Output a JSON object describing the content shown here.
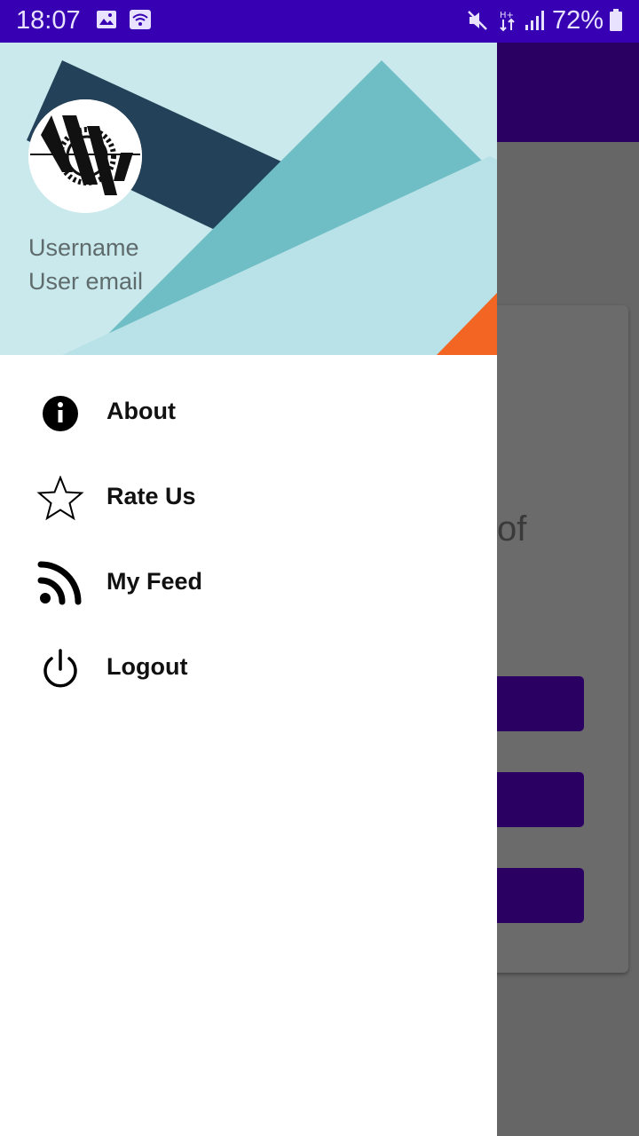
{
  "status_bar": {
    "time": "18:07",
    "battery": "72%",
    "icons": [
      "image-icon",
      "wifi-icon",
      "mute-icon",
      "data-arrows-icon",
      "signal-icon",
      "battery-icon"
    ]
  },
  "drawer": {
    "header": {
      "username": "Username",
      "email": "User email"
    },
    "items": [
      {
        "label": "About",
        "icon": "info-icon"
      },
      {
        "label": "Rate Us",
        "icon": "star-outline-icon"
      },
      {
        "label": "My Feed",
        "icon": "rss-feed-icon"
      },
      {
        "label": "Logout",
        "icon": "power-icon"
      }
    ]
  },
  "background_app": {
    "card_text": "of"
  },
  "colors": {
    "status_bar": "#3700b3",
    "app_bar": "#2a0063",
    "scrim": "#666666",
    "header_bg": "#c9e9ec",
    "accent_orange": "#f26522"
  }
}
